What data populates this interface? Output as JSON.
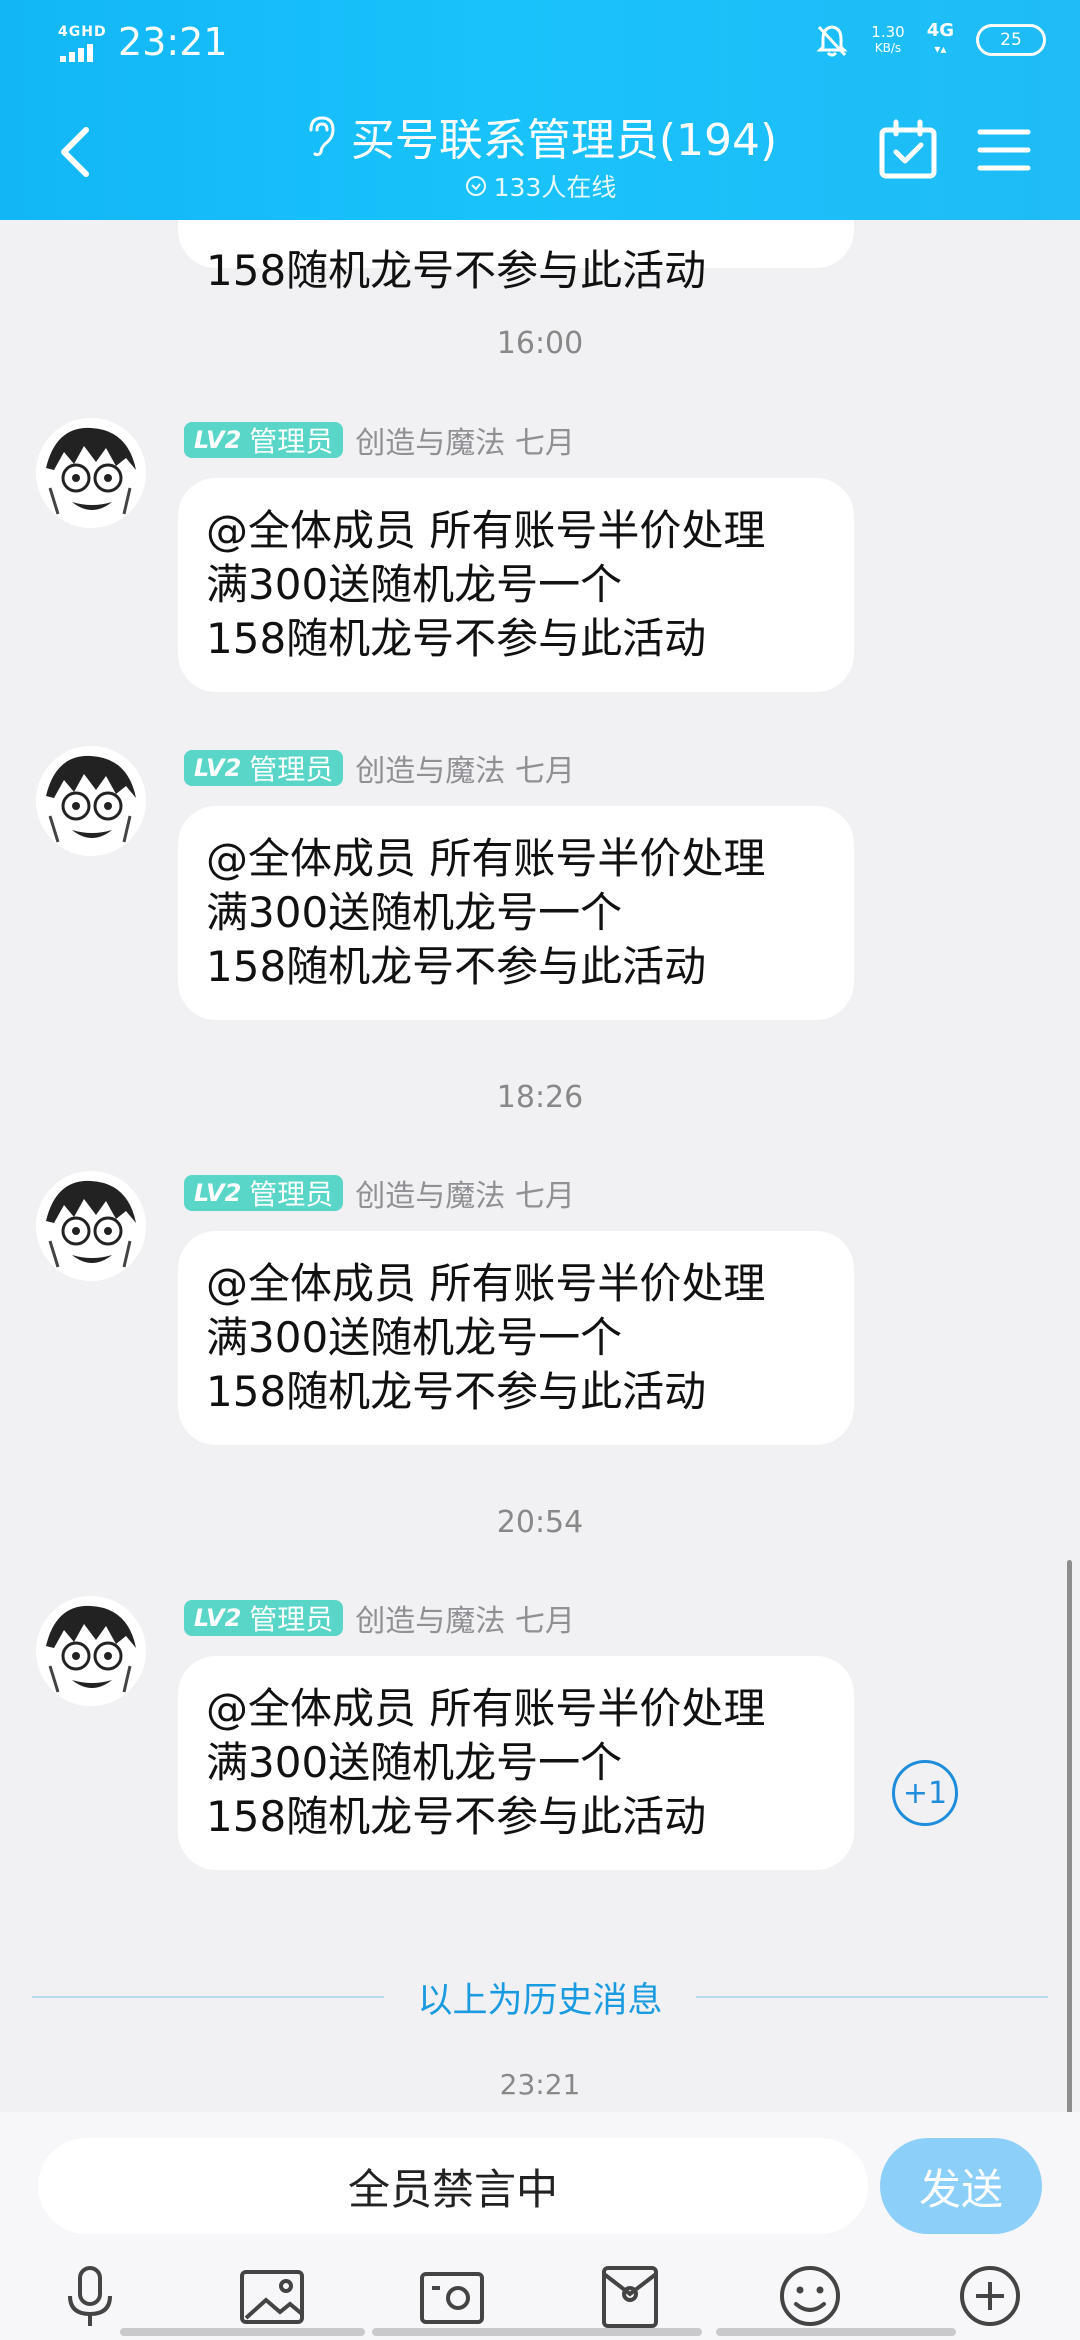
{
  "status_bar": {
    "network_label": "4GHD",
    "time": "23:21",
    "speed_value": "1.30",
    "speed_unit": "KB/s",
    "cell_label": "4G",
    "battery": "25"
  },
  "header": {
    "title": "买号联系管理员(194)",
    "online": "133人在线"
  },
  "messages": [
    {
      "sender": {
        "level": "LV2",
        "role": "管理员",
        "name": "创造与魔法 七月"
      },
      "text": "@全体成员 所有账号半价处理\n满300送随机龙号一个\n158随机龙号不参与此活动"
    },
    {
      "sender": {
        "level": "LV2",
        "role": "管理员",
        "name": "创造与魔法 七月"
      },
      "text": "@全体成员 所有账号半价处理\n满300送随机龙号一个\n158随机龙号不参与此活动"
    },
    {
      "sender": {
        "level": "LV2",
        "role": "管理员",
        "name": "创造与魔法 七月"
      },
      "text": "@全体成员 所有账号半价处理\n满300送随机龙号一个\n158随机龙号不参与此活动"
    },
    {
      "sender": {
        "level": "LV2",
        "role": "管理员",
        "name": "创造与魔法 七月"
      },
      "text": "@全体成员 所有账号半价处理\n满300送随机龙号一个\n158随机龙号不参与此活动"
    }
  ],
  "partial_message_text": "158随机龙号不参与此活动",
  "timestamps": [
    "16:00",
    "18:26",
    "20:54",
    "23:21"
  ],
  "plus_one": "+1",
  "history_divider": "以上为历史消息",
  "input": {
    "placeholder": "全员禁言中",
    "send": "发送"
  },
  "toolbar_icons": [
    "microphone-icon",
    "image-icon",
    "camera-icon",
    "red-packet-icon",
    "emoji-icon",
    "plus-icon"
  ],
  "colors": {
    "header": "#12b6f5",
    "admin_badge": "#5ad6c8",
    "link_blue": "#1a9be0",
    "send_button": "#8ccff8"
  }
}
